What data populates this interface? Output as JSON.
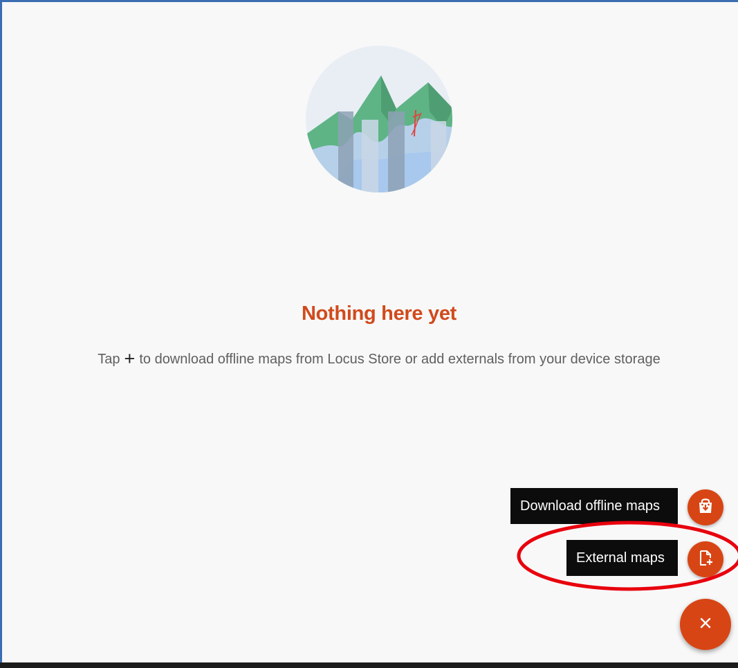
{
  "empty_state": {
    "illustration": "mountains-map-illustration",
    "title": "Nothing here yet",
    "desc_prefix": "Tap",
    "desc_plus_glyph": "+",
    "desc_suffix": "to download offline maps from Locus Store or add externals from your device storage"
  },
  "fab_menu": {
    "download": {
      "label": "Download offline maps",
      "icon": "shop-bag-download-icon"
    },
    "external": {
      "label": "External maps",
      "icon": "file-add-icon"
    },
    "main": {
      "icon": "close-icon"
    }
  },
  "colors": {
    "accent": "#d84515",
    "title": "#d14a1c",
    "tooltip_bg": "#0c0c0c",
    "annotation": "#e8000d"
  }
}
